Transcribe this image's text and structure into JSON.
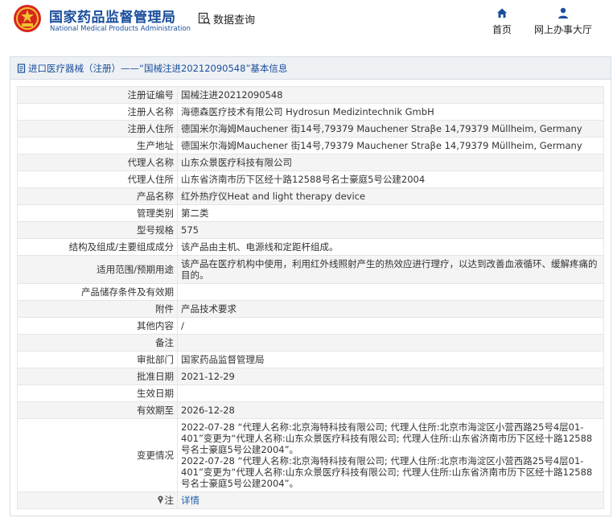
{
  "header": {
    "logo_cn": "国家药品监督管理局",
    "logo_en": "National Medical Products Administration",
    "data_query": "数据查询",
    "nav": [
      {
        "label": "首页",
        "icon": "home-icon"
      },
      {
        "label": "网上办事大厅",
        "icon": "user-icon"
      }
    ]
  },
  "panel": {
    "title": "进口医疗器械（注册）——“国械注进20212090548”基本信息"
  },
  "rows": [
    {
      "key": "注册证编号",
      "value": "国械注进20212090548"
    },
    {
      "key": "注册人名称",
      "value": "海德森医疗技术有限公司 Hydrosun Medizintechnik GmbH"
    },
    {
      "key": "注册人住所",
      "value": "德国米尔海姆Mauchener 街14号,79379 Mauchener Straβe 14,79379 Müllheim, Germany"
    },
    {
      "key": "生产地址",
      "value": "德国米尔海姆Mauchener 街14号,79379 Mauchener Straβe 14,79379 Müllheim, Germany"
    },
    {
      "key": "代理人名称",
      "value": "山东众景医疗科技有限公司"
    },
    {
      "key": "代理人住所",
      "value": "山东省济南市历下区经十路12588号名士豪庭5号公建2004"
    },
    {
      "key": "产品名称",
      "value": "红外热疗仪Heat and light therapy device"
    },
    {
      "key": "管理类别",
      "value": "第二类"
    },
    {
      "key": "型号规格",
      "value": "575"
    },
    {
      "key": "结构及组成/主要组成成分",
      "value": "该产品由主机、电源线和定距杆组成。"
    },
    {
      "key": "适用范围/预期用途",
      "value": "该产品在医疗机构中使用，利用红外线照射产生的热效应进行理疗，以达到改善血液循环、缓解疼痛的目的。"
    },
    {
      "key": "产品储存条件及有效期",
      "value": ""
    },
    {
      "key": "附件",
      "value": "产品技术要求"
    },
    {
      "key": "其他内容",
      "value": "/"
    },
    {
      "key": "备注",
      "value": ""
    },
    {
      "key": "审批部门",
      "value": "国家药品监督管理局"
    },
    {
      "key": "批准日期",
      "value": "2021-12-29"
    },
    {
      "key": "生效日期",
      "value": ""
    },
    {
      "key": "有效期至",
      "value": "2026-12-28"
    }
  ],
  "change": {
    "key": "变更情况",
    "lines": [
      "2022-07-28 “代理人名称:北京海特科技有限公司; 代理人住所:北京市海淀区小营西路25号4层01-401”变更为“代理人名称:山东众景医疗科技有限公司; 代理人住所:山东省济南市历下区经十路12588号名士豪庭5号公建2004”。",
      "2022-07-28 “代理人名称:北京海特科技有限公司; 代理人住所:北京市海淀区小营西路25号4层01-401”变更为“代理人名称:山东众景医疗科技有限公司; 代理人住所:山东省济南市历下区经十路12588号名士豪庭5号公建2004”。"
    ]
  },
  "note": {
    "key": "注",
    "icon": "note-pin-icon",
    "link": "详情"
  },
  "colors": {
    "brand_blue": "#1a4f9c",
    "link_blue": "#1a5ea8",
    "emblem_red": "#d7261e",
    "emblem_gold": "#f2c12e"
  }
}
